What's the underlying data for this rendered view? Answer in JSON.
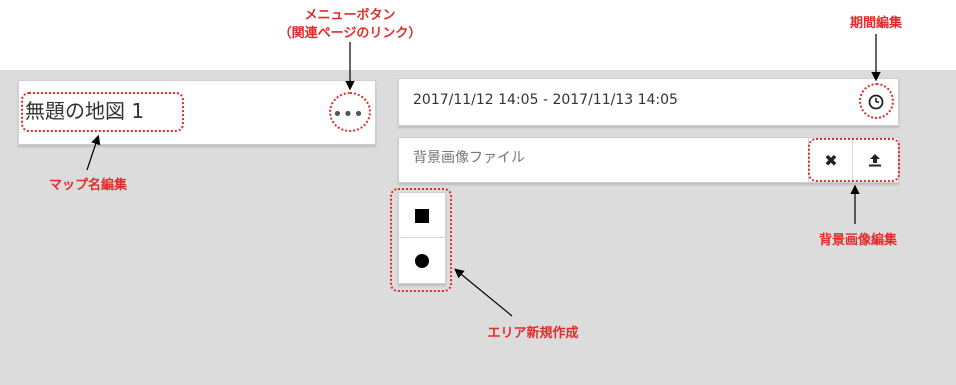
{
  "map_name": {
    "value": "無題の地図 1"
  },
  "menu_button": {
    "icon": "ellipsis-icon",
    "glyph": "•••"
  },
  "period": {
    "value": "2017/11/12 14:05 - 2017/11/13 14:05",
    "icon": "clock-icon"
  },
  "background_image": {
    "placeholder": "背景画像ファイル",
    "clear_glyph": "✖",
    "upload_icon": "upload-icon"
  },
  "area_tools": [
    {
      "shape": "square",
      "icon": "square-icon"
    },
    {
      "shape": "circle",
      "icon": "circle-icon"
    }
  ],
  "annotations": {
    "menu_line1": "メニューボタン",
    "menu_line2": "（関連ページのリンク）",
    "period_edit": "期間編集",
    "map_name_edit": "マップ名編集",
    "background_edit": "背景画像編集",
    "area_create": "エリア新規作成"
  },
  "colors": {
    "annotation": "#e32b2b",
    "canvas": "#dcdcdc"
  }
}
